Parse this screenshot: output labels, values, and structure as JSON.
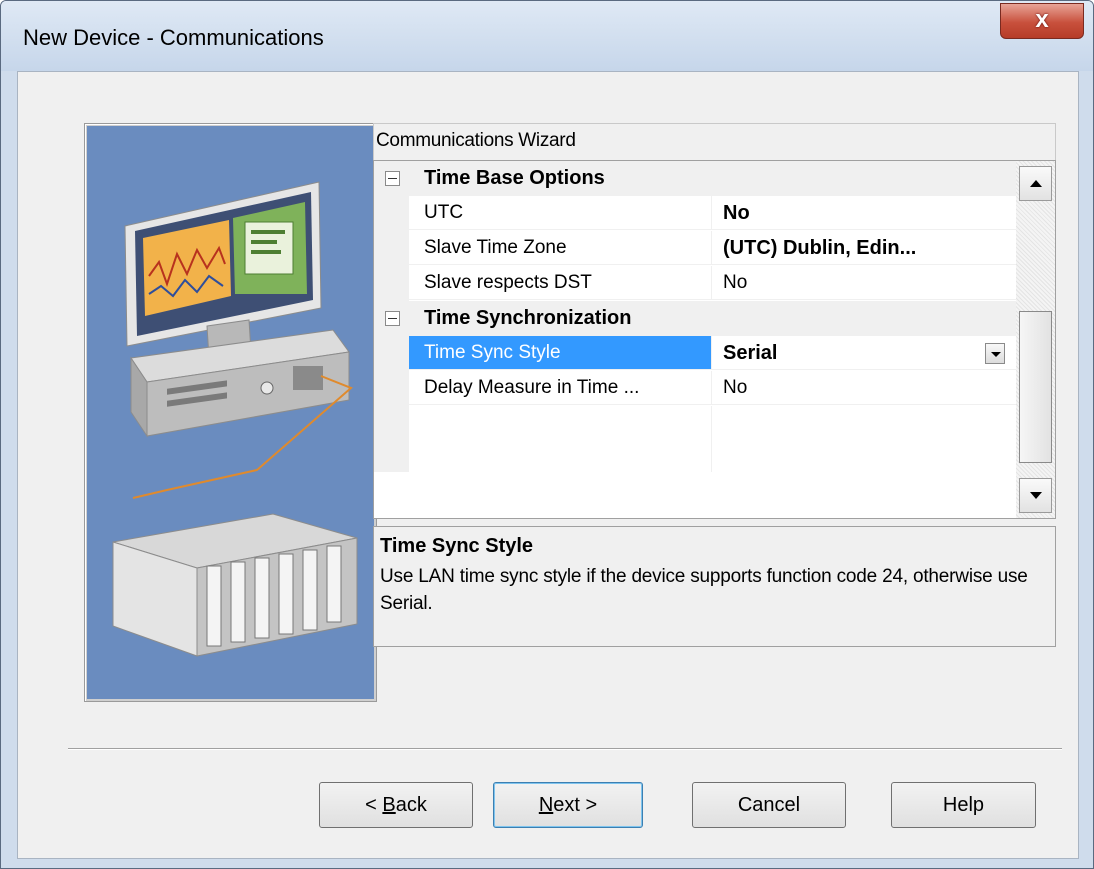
{
  "window": {
    "title": "New Device - Communications",
    "close_glyph": "x"
  },
  "wizard": {
    "header": "Communications Wizard"
  },
  "grid": {
    "cat1": {
      "label": "Time Base Options"
    },
    "cat2": {
      "label": "Time Synchronization"
    },
    "rows": [
      {
        "name": "UTC",
        "value": "No",
        "bold": true
      },
      {
        "name": "Slave Time Zone",
        "value": "(UTC) Dublin, Edin...",
        "bold": true
      },
      {
        "name": "Slave respects DST",
        "value": "No",
        "bold": false
      },
      {
        "name": "Time Sync Style",
        "value": "Serial",
        "bold": true,
        "selected": true
      },
      {
        "name": "Delay Measure in Time ...",
        "value": "No",
        "bold": false
      }
    ]
  },
  "description": {
    "title": "Time Sync Style",
    "text": "Use LAN time sync style if the device supports function code 24, otherwise use Serial."
  },
  "buttons": {
    "back_prefix": "< ",
    "back_key": "B",
    "back_rest": "ack",
    "next_key": "N",
    "next_rest": "ext >",
    "cancel": "Cancel",
    "help": "Help"
  },
  "colors": {
    "selection": "#3399ff",
    "picture_bg": "#6a8cbf"
  }
}
